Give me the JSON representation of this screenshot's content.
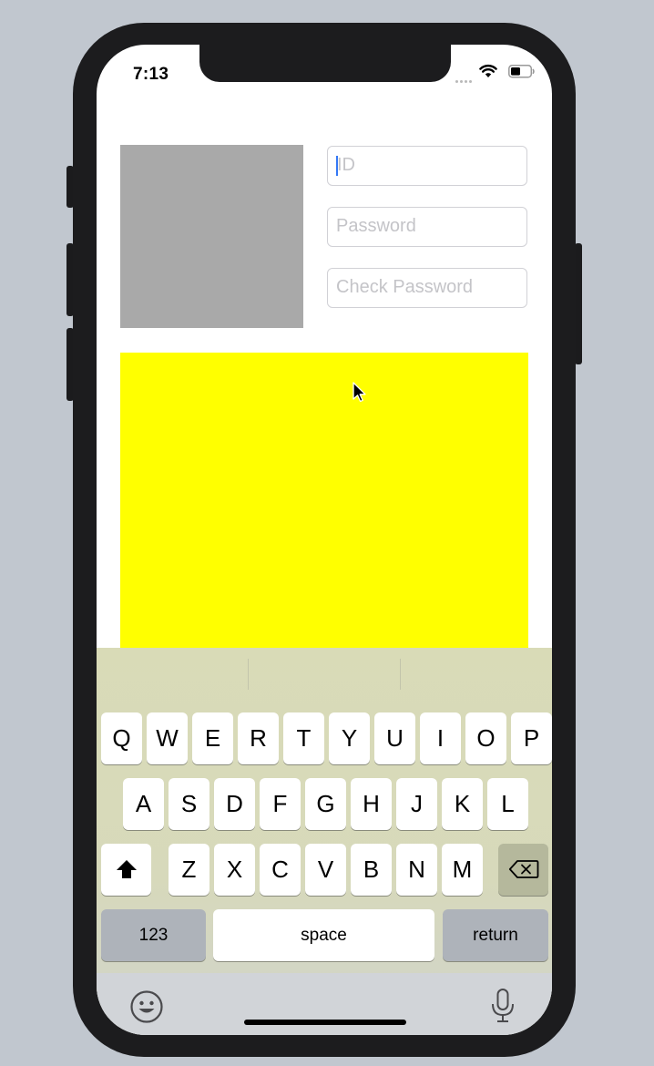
{
  "status_bar": {
    "time": "7:13",
    "icons": [
      "signal-dots-icon",
      "wifi-icon",
      "battery-icon"
    ]
  },
  "form": {
    "id_field": {
      "placeholder": "ID",
      "value": ""
    },
    "password_field": {
      "placeholder": "Password",
      "value": ""
    },
    "check_password_field": {
      "placeholder": "Check Password",
      "value": ""
    }
  },
  "colors": {
    "image_placeholder": "#a9a9a9",
    "content_view": "#ffff00",
    "caret": "#3478f6"
  },
  "keyboard": {
    "row1": [
      "Q",
      "W",
      "E",
      "R",
      "T",
      "Y",
      "U",
      "I",
      "O",
      "P"
    ],
    "row2": [
      "A",
      "S",
      "D",
      "F",
      "G",
      "H",
      "J",
      "K",
      "L"
    ],
    "row3": [
      "Z",
      "X",
      "C",
      "V",
      "B",
      "N",
      "M"
    ],
    "numbers_key": "123",
    "space_key": "space",
    "return_key": "return",
    "icons": [
      "shift-icon",
      "delete-icon",
      "emoji-icon",
      "microphone-icon"
    ]
  }
}
